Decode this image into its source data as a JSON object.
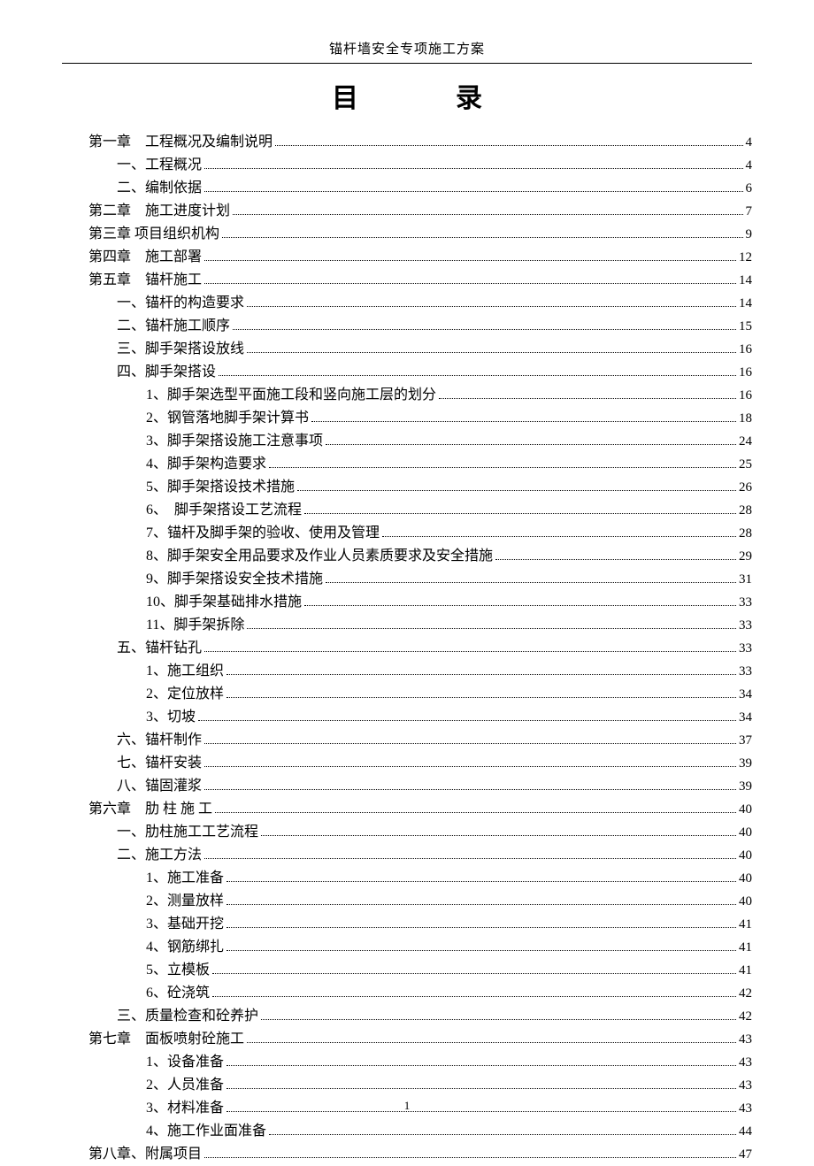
{
  "doc_header": "锚杆墙安全专项施工方案",
  "toc_heading": "目　录",
  "footer_page": "1",
  "toc": [
    {
      "indent": 0,
      "text": "第一章　工程概况及编制说明",
      "page": "4"
    },
    {
      "indent": 1,
      "text": "一、工程概况",
      "page": "4"
    },
    {
      "indent": 1,
      "text": "二、编制依据",
      "page": "6"
    },
    {
      "indent": 0,
      "text": "第二章　施工进度计划",
      "page": "7"
    },
    {
      "indent": 0,
      "text": "第三章 项目组织机构",
      "page": "9"
    },
    {
      "indent": 0,
      "text": "第四章　施工部署",
      "page": "12"
    },
    {
      "indent": 0,
      "text": "第五章　锚杆施工",
      "page": "14"
    },
    {
      "indent": 1,
      "text": "一、锚杆的构造要求",
      "page": "14"
    },
    {
      "indent": 1,
      "text": "二、锚杆施工顺序",
      "page": "15"
    },
    {
      "indent": 1,
      "text": "三、脚手架搭设放线",
      "page": "16"
    },
    {
      "indent": 1,
      "text": "四、脚手架搭设",
      "page": "16"
    },
    {
      "indent": 2,
      "text": "1、脚手架选型平面施工段和竖向施工层的划分",
      "page": "16"
    },
    {
      "indent": 2,
      "text": "2、钢管落地脚手架计算书",
      "page": "18"
    },
    {
      "indent": 2,
      "text": "3、脚手架搭设施工注意事项",
      "page": "24"
    },
    {
      "indent": 2,
      "text": "4、脚手架构造要求",
      "page": "25"
    },
    {
      "indent": 2,
      "text": "5、脚手架搭设技术措施",
      "page": "26"
    },
    {
      "indent": 2,
      "text": "6、　脚手架搭设工艺流程",
      "page": "28"
    },
    {
      "indent": 2,
      "text": "7、锚杆及脚手架的验收、使用及管理",
      "page": "28"
    },
    {
      "indent": 2,
      "text": "8、脚手架安全用品要求及作业人员素质要求及安全措施",
      "page": "29"
    },
    {
      "indent": 2,
      "text": "9、脚手架搭设安全技术措施",
      "page": "31"
    },
    {
      "indent": 2,
      "text": "10、脚手架基础排水措施",
      "page": "33"
    },
    {
      "indent": 2,
      "text": "11、脚手架拆除",
      "page": "33"
    },
    {
      "indent": 1,
      "text": "五、锚杆钻孔",
      "page": "33"
    },
    {
      "indent": 2,
      "text": "1、施工组织",
      "page": "33"
    },
    {
      "indent": 2,
      "text": "2、定位放样",
      "page": "34"
    },
    {
      "indent": 2,
      "text": "3、切坡",
      "page": "34"
    },
    {
      "indent": 1,
      "text": "六、锚杆制作",
      "page": "37"
    },
    {
      "indent": 1,
      "text": "七、锚杆安装",
      "page": "39"
    },
    {
      "indent": 1,
      "text": "八、锚固灌浆",
      "page": "39"
    },
    {
      "indent": 0,
      "text": "第六章　肋 柱 施 工",
      "page": "40"
    },
    {
      "indent": 1,
      "text": "一、肋柱施工工艺流程",
      "page": "40"
    },
    {
      "indent": 1,
      "text": "二、施工方法",
      "page": "40"
    },
    {
      "indent": 2,
      "text": "1、施工准备",
      "page": "40"
    },
    {
      "indent": 2,
      "text": "2、测量放样",
      "page": "40"
    },
    {
      "indent": 2,
      "text": "3、基础开挖",
      "page": "41"
    },
    {
      "indent": 2,
      "text": "4、钢筋绑扎",
      "page": "41"
    },
    {
      "indent": 2,
      "text": "5、立模板",
      "page": "41"
    },
    {
      "indent": 2,
      "text": "6、砼浇筑",
      "page": "42"
    },
    {
      "indent": 1,
      "text": "三、质量检查和砼养护",
      "page": "42"
    },
    {
      "indent": 0,
      "text": "第七章　面板喷射砼施工",
      "page": "43"
    },
    {
      "indent": 2,
      "text": "1、设备准备",
      "page": "43"
    },
    {
      "indent": 2,
      "text": "2、人员准备",
      "page": "43"
    },
    {
      "indent": 2,
      "text": "3、材料准备",
      "page": "43"
    },
    {
      "indent": 2,
      "text": "4、施工作业面准备",
      "page": "44"
    },
    {
      "indent": 0,
      "text": "第八章、附属项目",
      "page": "47"
    }
  ]
}
